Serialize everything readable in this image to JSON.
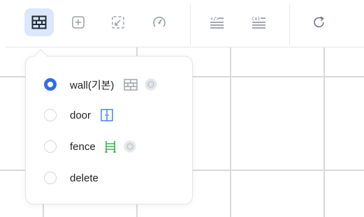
{
  "toolbar": {
    "buttons": [
      {
        "name": "wall-tool",
        "icon": "brick-wall-icon",
        "active": true
      },
      {
        "name": "add-tool",
        "icon": "plus-square-icon",
        "active": false
      },
      {
        "name": "resize-tool",
        "icon": "expand-corner-icon",
        "active": false
      },
      {
        "name": "gauge-tool",
        "icon": "gauge-icon",
        "active": false
      },
      {
        "name": "code-view",
        "icon": "code-lines-icon",
        "active": false
      },
      {
        "name": "variable-view",
        "icon": "variable-lines-icon",
        "active": false
      },
      {
        "name": "refresh",
        "icon": "refresh-icon",
        "active": false
      }
    ]
  },
  "popup": {
    "options": [
      {
        "label": "wall(기본)",
        "selected": true,
        "icon": "brick-wall-icon",
        "icon_color": "#9aa0a6",
        "has_settings": true
      },
      {
        "label": "door",
        "selected": false,
        "icon": "door-icon",
        "icon_color": "#3b7be8",
        "has_settings": false
      },
      {
        "label": "fence",
        "selected": false,
        "icon": "fence-icon",
        "icon_color": "#2fb344",
        "has_settings": true
      },
      {
        "label": "delete",
        "selected": false,
        "icon": "",
        "has_settings": false
      }
    ]
  },
  "colors": {
    "accent": "#2f6fe4",
    "active_bg": "#dbe7fb",
    "icon_gray": "#9aa0a6",
    "grid_line": "#d9d9d9"
  }
}
